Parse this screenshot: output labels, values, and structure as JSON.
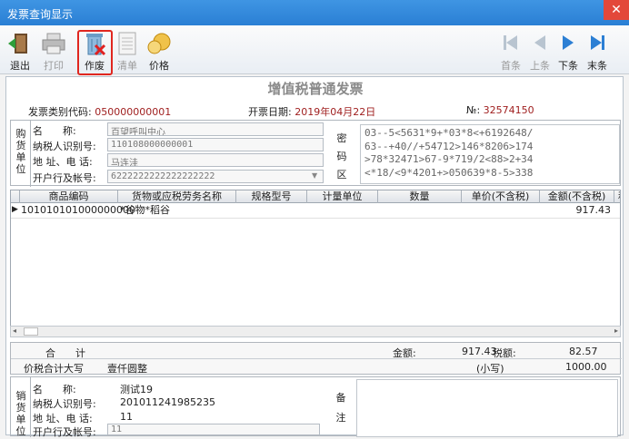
{
  "window": {
    "title": "发票查询显示",
    "close": "✕"
  },
  "toolbar": {
    "exit": "退出",
    "print": "打印",
    "void": "作废",
    "list": "清单",
    "price": "价格",
    "first": "首条",
    "prev": "上条",
    "next": "下条",
    "last": "末条"
  },
  "invoice": {
    "title": "增值税普通发票",
    "type_code_label": "发票类别代码:",
    "type_code": "050000000001",
    "date_label": "开票日期:",
    "date": "2019年04月22日",
    "no_label": "№:",
    "no": "32574150"
  },
  "buyer": {
    "section": "购货单位",
    "name_label": "名　　称:",
    "name": "百望呼叫中心",
    "tax_label": "纳税人识别号:",
    "tax": "110108000000001",
    "addr_label": "地 址、电 话:",
    "addr": "马连洼",
    "bank_label": "开户行及帐号:",
    "bank": "6222222222222222222"
  },
  "cipher": {
    "section": "密码区",
    "lines": [
      "03--5<5631*9+*03*8<+6192648/",
      "63--+40//+54712>146*8206>174",
      ">78*32471>67-9*719/2<88>2+34",
      "<*18/<9*4201+>050639*8-5>338"
    ]
  },
  "table": {
    "headers": [
      "商品编码",
      "货物或应税劳务名称",
      "规格型号",
      "计量单位",
      "数量",
      "单价(不含税)",
      "金额(不含税)",
      "税"
    ],
    "row": {
      "code": "101010101000000000",
      "name": "*谷物*稻谷",
      "amount": "917.43"
    }
  },
  "totals": {
    "total_label": "合　　计",
    "amount_label": "金额:",
    "amount": "917.43",
    "tax_label": "税额:",
    "tax": "82.57",
    "sum_label": "价税合计大写",
    "sum_upper": "壹仟圆整",
    "small_label": "(小写)",
    "small": "1000.00"
  },
  "seller": {
    "section": "销货单位",
    "name_label": "名　　称:",
    "name": "测试19",
    "tax_label": "纳税人识别号:",
    "tax": "201011241985235",
    "addr_label": "地 址、电 话:",
    "addr": "11",
    "bank_label": "开户行及帐号:",
    "bank": "11",
    "note_label": "备注"
  },
  "colors": {
    "titlebar": "#2a7fd4",
    "highlight": "#e0261f",
    "accent_red": "#a02020"
  }
}
